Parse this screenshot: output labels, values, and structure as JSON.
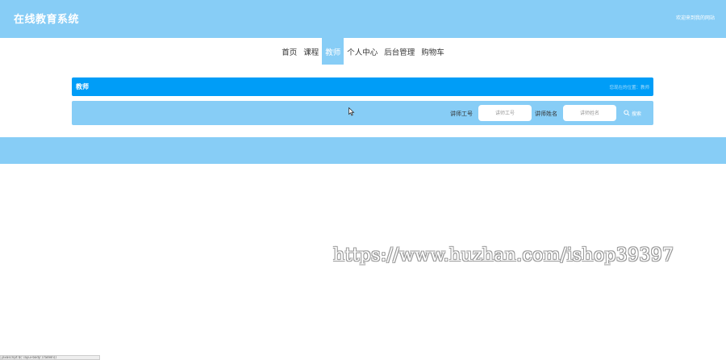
{
  "header": {
    "site_title": "在线教育系统",
    "welcome": "欢迎来到我的网站"
  },
  "nav": {
    "items": [
      "首页",
      "课程",
      "教师",
      "个人中心",
      "后台管理",
      "购物车"
    ],
    "active_index": 2
  },
  "section": {
    "title": "教师",
    "breadcrumb": "您现在的位置：教师"
  },
  "search": {
    "teacher_id_label": "讲师工号",
    "teacher_id_placeholder": "讲师工号",
    "teacher_name_label": "讲师姓名",
    "teacher_name_placeholder": "讲师姓名",
    "search_button": "搜索"
  },
  "watermark": "https://www.huzhan.com/ishop39397",
  "status_bar": "javascript:$('.layui-body').fadeIn()",
  "colors": {
    "header_bg": "#87cdf6",
    "title_bar_bg": "#009df7",
    "nav_active_bg": "#87cdf6"
  }
}
